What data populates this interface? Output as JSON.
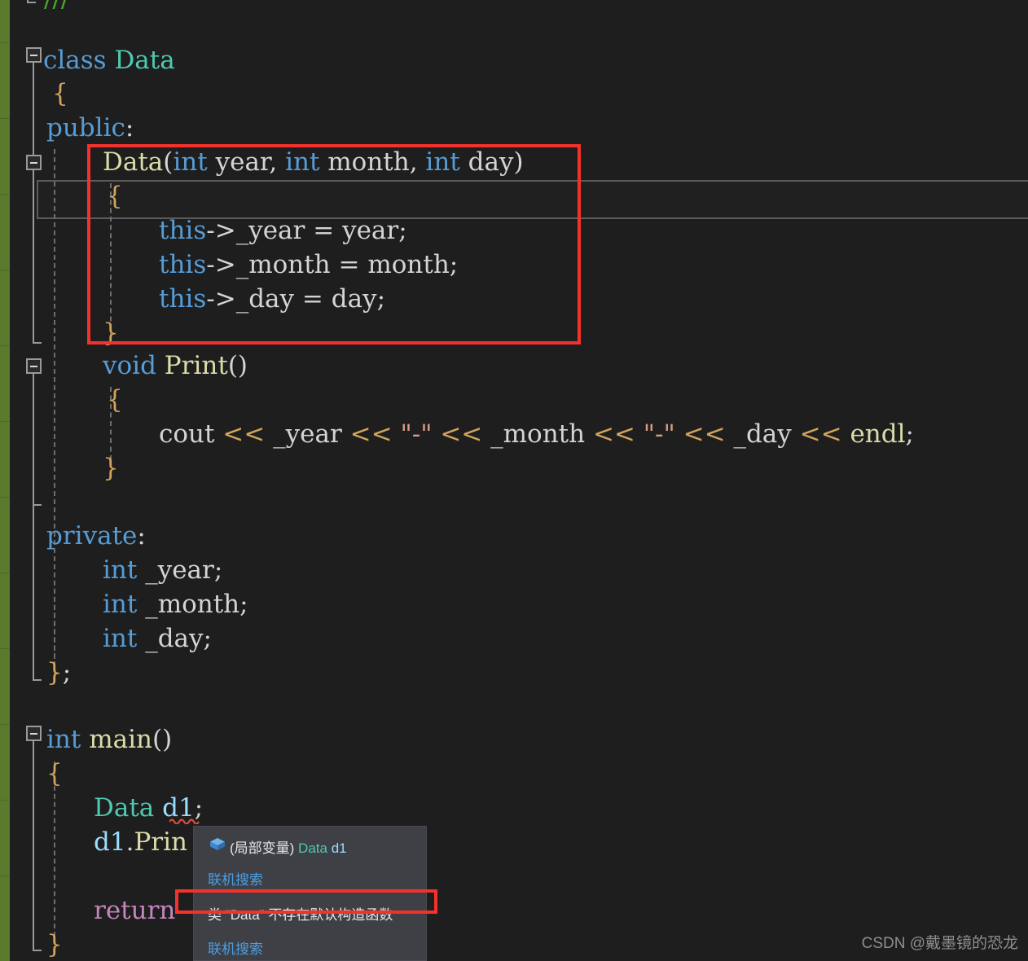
{
  "app": {
    "kind": "visual-studio-cpp-editor",
    "theme": "dark",
    "background": "#1e1e1e",
    "change_bar_color": "#5a7a2e"
  },
  "code": {
    "lines": [
      {
        "id": "l0",
        "indent": 0,
        "text": "///",
        "tokens": [
          {
            "t": "///",
            "c": "cmt"
          }
        ]
      },
      {
        "id": "l1",
        "indent": 0,
        "text": "class Data",
        "tokens": [
          {
            "t": "class ",
            "c": "kw"
          },
          {
            "t": "Data",
            "c": "type"
          }
        ]
      },
      {
        "id": "l2",
        "indent": 1,
        "text": "{",
        "tokens": [
          {
            "t": "{",
            "c": "brace"
          }
        ]
      },
      {
        "id": "l3",
        "indent": 1,
        "text": "public:",
        "tokens": [
          {
            "t": "public",
            "c": "kw"
          },
          {
            "t": ":",
            "c": "punc"
          }
        ]
      },
      {
        "id": "l4",
        "indent": 2,
        "text": "Data(int year, int month, int day)",
        "tokens": [
          {
            "t": "Data",
            "c": "fn"
          },
          {
            "t": "(",
            "c": "punc"
          },
          {
            "t": "int",
            "c": "kw"
          },
          {
            "t": " year, ",
            "c": "id"
          },
          {
            "t": "int",
            "c": "kw"
          },
          {
            "t": " month, ",
            "c": "id"
          },
          {
            "t": "int",
            "c": "kw"
          },
          {
            "t": " day",
            "c": "id"
          },
          {
            "t": ")",
            "c": "punc"
          }
        ]
      },
      {
        "id": "l5",
        "indent": 2,
        "text": "{",
        "tokens": [
          {
            "t": "{",
            "c": "brace"
          }
        ]
      },
      {
        "id": "l6",
        "indent": 3,
        "text": "this->_year = year;",
        "tokens": [
          {
            "t": "this",
            "c": "kw"
          },
          {
            "t": "->",
            "c": "punc"
          },
          {
            "t": "_year",
            "c": "id"
          },
          {
            "t": " = ",
            "c": "punc"
          },
          {
            "t": "year",
            "c": "id"
          },
          {
            "t": ";",
            "c": "punc"
          }
        ]
      },
      {
        "id": "l7",
        "indent": 3,
        "text": "this->_month = month;",
        "tokens": [
          {
            "t": "this",
            "c": "kw"
          },
          {
            "t": "->",
            "c": "punc"
          },
          {
            "t": "_month",
            "c": "id"
          },
          {
            "t": " = ",
            "c": "punc"
          },
          {
            "t": "month",
            "c": "id"
          },
          {
            "t": ";",
            "c": "punc"
          }
        ]
      },
      {
        "id": "l8",
        "indent": 3,
        "text": "this->_day = day;",
        "tokens": [
          {
            "t": "this",
            "c": "kw"
          },
          {
            "t": "->",
            "c": "punc"
          },
          {
            "t": "_day",
            "c": "id"
          },
          {
            "t": " = ",
            "c": "punc"
          },
          {
            "t": "day",
            "c": "id"
          },
          {
            "t": ";",
            "c": "punc"
          }
        ]
      },
      {
        "id": "l9",
        "indent": 2,
        "text": "}",
        "tokens": [
          {
            "t": "}",
            "c": "brace"
          }
        ]
      },
      {
        "id": "l10",
        "indent": 2,
        "text": "void Print()",
        "tokens": [
          {
            "t": "void",
            "c": "kw"
          },
          {
            "t": " ",
            "c": "id"
          },
          {
            "t": "Print",
            "c": "fn"
          },
          {
            "t": "()",
            "c": "punc"
          }
        ]
      },
      {
        "id": "l11",
        "indent": 2,
        "text": "{",
        "tokens": [
          {
            "t": "{",
            "c": "brace"
          }
        ]
      },
      {
        "id": "l12",
        "indent": 3,
        "text": "cout << _year << \"-\" << _month << \"-\" << _day << endl;",
        "tokens": [
          {
            "t": "cout",
            "c": "id"
          },
          {
            "t": " << ",
            "c": "op"
          },
          {
            "t": "_year",
            "c": "id"
          },
          {
            "t": " << ",
            "c": "op"
          },
          {
            "t": "\"-\"",
            "c": "str"
          },
          {
            "t": " << ",
            "c": "op"
          },
          {
            "t": "_month",
            "c": "id"
          },
          {
            "t": " << ",
            "c": "op"
          },
          {
            "t": "\"-\"",
            "c": "str"
          },
          {
            "t": " << ",
            "c": "op"
          },
          {
            "t": "_day",
            "c": "id"
          },
          {
            "t": " << ",
            "c": "op"
          },
          {
            "t": "endl",
            "c": "fn"
          },
          {
            "t": ";",
            "c": "punc"
          }
        ]
      },
      {
        "id": "l13",
        "indent": 2,
        "text": "}",
        "tokens": [
          {
            "t": "}",
            "c": "brace"
          }
        ]
      },
      {
        "id": "l14",
        "indent": 1,
        "text": "private:",
        "tokens": [
          {
            "t": "private",
            "c": "kw"
          },
          {
            "t": ":",
            "c": "punc"
          }
        ]
      },
      {
        "id": "l15",
        "indent": 2,
        "text": "int _year;",
        "tokens": [
          {
            "t": "int",
            "c": "kw"
          },
          {
            "t": " _year",
            "c": "id"
          },
          {
            "t": ";",
            "c": "punc"
          }
        ]
      },
      {
        "id": "l16",
        "indent": 2,
        "text": "int _month;",
        "tokens": [
          {
            "t": "int",
            "c": "kw"
          },
          {
            "t": " _month",
            "c": "id"
          },
          {
            "t": ";",
            "c": "punc"
          }
        ]
      },
      {
        "id": "l17",
        "indent": 2,
        "text": "int _day;",
        "tokens": [
          {
            "t": "int",
            "c": "kw"
          },
          {
            "t": " _day",
            "c": "id"
          },
          {
            "t": ";",
            "c": "punc"
          }
        ]
      },
      {
        "id": "l18",
        "indent": 1,
        "text": "};",
        "tokens": [
          {
            "t": "}",
            "c": "brace"
          },
          {
            "t": ";",
            "c": "punc"
          }
        ]
      },
      {
        "id": "l19",
        "indent": 0,
        "text": "int main()",
        "tokens": [
          {
            "t": "int",
            "c": "kw"
          },
          {
            "t": " ",
            "c": "id"
          },
          {
            "t": "main",
            "c": "fn"
          },
          {
            "t": "()",
            "c": "punc"
          }
        ]
      },
      {
        "id": "l20",
        "indent": 1,
        "text": "{",
        "tokens": [
          {
            "t": "{",
            "c": "brace"
          }
        ]
      },
      {
        "id": "l21",
        "indent": 2,
        "text": "Data d1;",
        "tokens": [
          {
            "t": "Data",
            "c": "type"
          },
          {
            "t": " ",
            "c": "id"
          },
          {
            "t": "d1",
            "c": "var"
          },
          {
            "t": ";",
            "c": "punc"
          }
        ]
      },
      {
        "id": "l22",
        "indent": 2,
        "text": "d1.Prin",
        "tokens": [
          {
            "t": "d1",
            "c": "var"
          },
          {
            "t": ".",
            "c": "punc"
          },
          {
            "t": "Prin",
            "c": "fn"
          }
        ]
      },
      {
        "id": "l23",
        "indent": 2,
        "text": "return",
        "tokens": [
          {
            "t": "return",
            "c": "ctl"
          }
        ]
      },
      {
        "id": "l24",
        "indent": 1,
        "text": "}",
        "tokens": [
          {
            "t": "}",
            "c": "brace"
          }
        ]
      }
    ]
  },
  "tooltip": {
    "icon_name": "local-variable-box-icon",
    "signature_prefix": "(局部变量) ",
    "signature_type": "Data",
    "signature_name": " d1",
    "online_search_label_1": "联机搜索",
    "error_message": "类 \"Data\" 不存在默认构造函数",
    "online_search_label_2": "联机搜索"
  },
  "annotations": {
    "constructor_box_label": "constructor-highlight",
    "error_box_label": "error-message-highlight",
    "box_color": "#f5312c"
  },
  "watermark": {
    "text": "CSDN @戴墨镜的恐龙"
  }
}
